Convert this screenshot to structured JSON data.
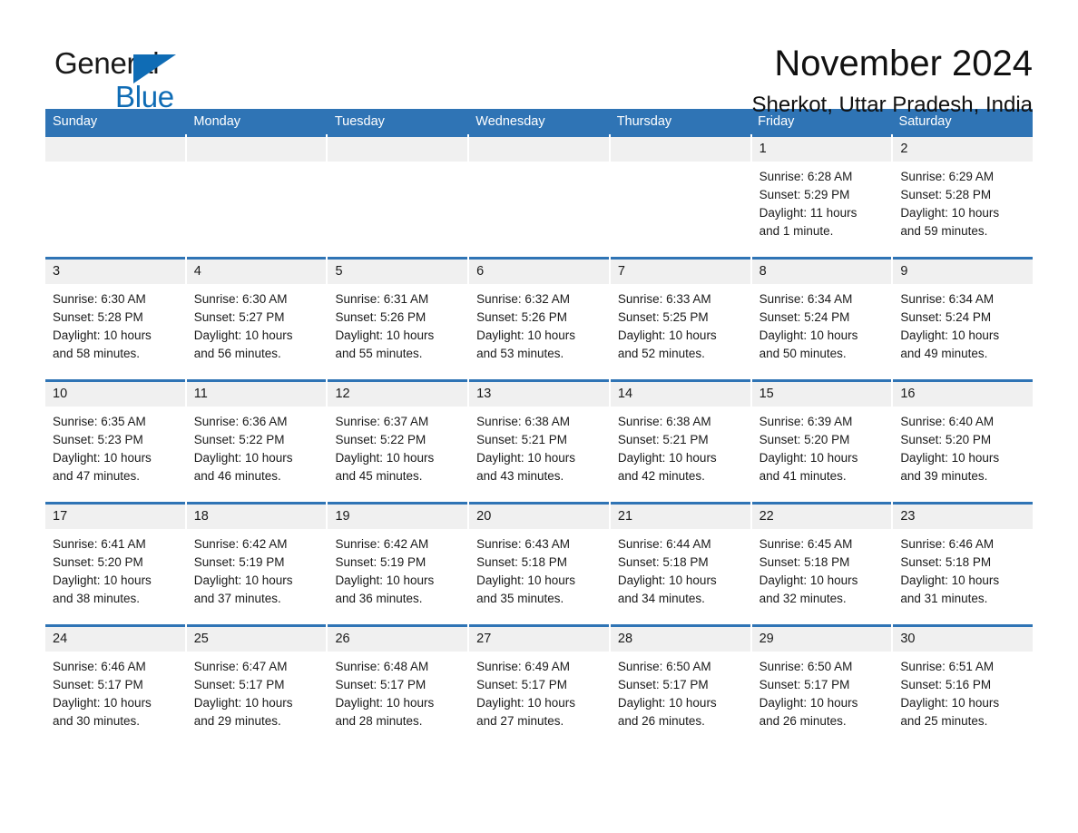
{
  "brand": {
    "word_one": "General",
    "word_two": "Blue",
    "flag_icon": "triangle-flag-icon",
    "accent_color": "#0f6cb5"
  },
  "header": {
    "title": "November 2024",
    "location": "Sherkot, Uttar Pradesh, India"
  },
  "calendar": {
    "header_bg": "#2f74b5",
    "date_strip_bg": "#f0f0f0",
    "weekdays": [
      "Sunday",
      "Monday",
      "Tuesday",
      "Wednesday",
      "Thursday",
      "Friday",
      "Saturday"
    ],
    "weeks": [
      [
        {
          "day": "",
          "sunrise": "",
          "sunset": "",
          "daylight_line1": "",
          "daylight_line2": ""
        },
        {
          "day": "",
          "sunrise": "",
          "sunset": "",
          "daylight_line1": "",
          "daylight_line2": ""
        },
        {
          "day": "",
          "sunrise": "",
          "sunset": "",
          "daylight_line1": "",
          "daylight_line2": ""
        },
        {
          "day": "",
          "sunrise": "",
          "sunset": "",
          "daylight_line1": "",
          "daylight_line2": ""
        },
        {
          "day": "",
          "sunrise": "",
          "sunset": "",
          "daylight_line1": "",
          "daylight_line2": ""
        },
        {
          "day": "1",
          "sunrise": "Sunrise: 6:28 AM",
          "sunset": "Sunset: 5:29 PM",
          "daylight_line1": "Daylight: 11 hours",
          "daylight_line2": "and 1 minute."
        },
        {
          "day": "2",
          "sunrise": "Sunrise: 6:29 AM",
          "sunset": "Sunset: 5:28 PM",
          "daylight_line1": "Daylight: 10 hours",
          "daylight_line2": "and 59 minutes."
        }
      ],
      [
        {
          "day": "3",
          "sunrise": "Sunrise: 6:30 AM",
          "sunset": "Sunset: 5:28 PM",
          "daylight_line1": "Daylight: 10 hours",
          "daylight_line2": "and 58 minutes."
        },
        {
          "day": "4",
          "sunrise": "Sunrise: 6:30 AM",
          "sunset": "Sunset: 5:27 PM",
          "daylight_line1": "Daylight: 10 hours",
          "daylight_line2": "and 56 minutes."
        },
        {
          "day": "5",
          "sunrise": "Sunrise: 6:31 AM",
          "sunset": "Sunset: 5:26 PM",
          "daylight_line1": "Daylight: 10 hours",
          "daylight_line2": "and 55 minutes."
        },
        {
          "day": "6",
          "sunrise": "Sunrise: 6:32 AM",
          "sunset": "Sunset: 5:26 PM",
          "daylight_line1": "Daylight: 10 hours",
          "daylight_line2": "and 53 minutes."
        },
        {
          "day": "7",
          "sunrise": "Sunrise: 6:33 AM",
          "sunset": "Sunset: 5:25 PM",
          "daylight_line1": "Daylight: 10 hours",
          "daylight_line2": "and 52 minutes."
        },
        {
          "day": "8",
          "sunrise": "Sunrise: 6:34 AM",
          "sunset": "Sunset: 5:24 PM",
          "daylight_line1": "Daylight: 10 hours",
          "daylight_line2": "and 50 minutes."
        },
        {
          "day": "9",
          "sunrise": "Sunrise: 6:34 AM",
          "sunset": "Sunset: 5:24 PM",
          "daylight_line1": "Daylight: 10 hours",
          "daylight_line2": "and 49 minutes."
        }
      ],
      [
        {
          "day": "10",
          "sunrise": "Sunrise: 6:35 AM",
          "sunset": "Sunset: 5:23 PM",
          "daylight_line1": "Daylight: 10 hours",
          "daylight_line2": "and 47 minutes."
        },
        {
          "day": "11",
          "sunrise": "Sunrise: 6:36 AM",
          "sunset": "Sunset: 5:22 PM",
          "daylight_line1": "Daylight: 10 hours",
          "daylight_line2": "and 46 minutes."
        },
        {
          "day": "12",
          "sunrise": "Sunrise: 6:37 AM",
          "sunset": "Sunset: 5:22 PM",
          "daylight_line1": "Daylight: 10 hours",
          "daylight_line2": "and 45 minutes."
        },
        {
          "day": "13",
          "sunrise": "Sunrise: 6:38 AM",
          "sunset": "Sunset: 5:21 PM",
          "daylight_line1": "Daylight: 10 hours",
          "daylight_line2": "and 43 minutes."
        },
        {
          "day": "14",
          "sunrise": "Sunrise: 6:38 AM",
          "sunset": "Sunset: 5:21 PM",
          "daylight_line1": "Daylight: 10 hours",
          "daylight_line2": "and 42 minutes."
        },
        {
          "day": "15",
          "sunrise": "Sunrise: 6:39 AM",
          "sunset": "Sunset: 5:20 PM",
          "daylight_line1": "Daylight: 10 hours",
          "daylight_line2": "and 41 minutes."
        },
        {
          "day": "16",
          "sunrise": "Sunrise: 6:40 AM",
          "sunset": "Sunset: 5:20 PM",
          "daylight_line1": "Daylight: 10 hours",
          "daylight_line2": "and 39 minutes."
        }
      ],
      [
        {
          "day": "17",
          "sunrise": "Sunrise: 6:41 AM",
          "sunset": "Sunset: 5:20 PM",
          "daylight_line1": "Daylight: 10 hours",
          "daylight_line2": "and 38 minutes."
        },
        {
          "day": "18",
          "sunrise": "Sunrise: 6:42 AM",
          "sunset": "Sunset: 5:19 PM",
          "daylight_line1": "Daylight: 10 hours",
          "daylight_line2": "and 37 minutes."
        },
        {
          "day": "19",
          "sunrise": "Sunrise: 6:42 AM",
          "sunset": "Sunset: 5:19 PM",
          "daylight_line1": "Daylight: 10 hours",
          "daylight_line2": "and 36 minutes."
        },
        {
          "day": "20",
          "sunrise": "Sunrise: 6:43 AM",
          "sunset": "Sunset: 5:18 PM",
          "daylight_line1": "Daylight: 10 hours",
          "daylight_line2": "and 35 minutes."
        },
        {
          "day": "21",
          "sunrise": "Sunrise: 6:44 AM",
          "sunset": "Sunset: 5:18 PM",
          "daylight_line1": "Daylight: 10 hours",
          "daylight_line2": "and 34 minutes."
        },
        {
          "day": "22",
          "sunrise": "Sunrise: 6:45 AM",
          "sunset": "Sunset: 5:18 PM",
          "daylight_line1": "Daylight: 10 hours",
          "daylight_line2": "and 32 minutes."
        },
        {
          "day": "23",
          "sunrise": "Sunrise: 6:46 AM",
          "sunset": "Sunset: 5:18 PM",
          "daylight_line1": "Daylight: 10 hours",
          "daylight_line2": "and 31 minutes."
        }
      ],
      [
        {
          "day": "24",
          "sunrise": "Sunrise: 6:46 AM",
          "sunset": "Sunset: 5:17 PM",
          "daylight_line1": "Daylight: 10 hours",
          "daylight_line2": "and 30 minutes."
        },
        {
          "day": "25",
          "sunrise": "Sunrise: 6:47 AM",
          "sunset": "Sunset: 5:17 PM",
          "daylight_line1": "Daylight: 10 hours",
          "daylight_line2": "and 29 minutes."
        },
        {
          "day": "26",
          "sunrise": "Sunrise: 6:48 AM",
          "sunset": "Sunset: 5:17 PM",
          "daylight_line1": "Daylight: 10 hours",
          "daylight_line2": "and 28 minutes."
        },
        {
          "day": "27",
          "sunrise": "Sunrise: 6:49 AM",
          "sunset": "Sunset: 5:17 PM",
          "daylight_line1": "Daylight: 10 hours",
          "daylight_line2": "and 27 minutes."
        },
        {
          "day": "28",
          "sunrise": "Sunrise: 6:50 AM",
          "sunset": "Sunset: 5:17 PM",
          "daylight_line1": "Daylight: 10 hours",
          "daylight_line2": "and 26 minutes."
        },
        {
          "day": "29",
          "sunrise": "Sunrise: 6:50 AM",
          "sunset": "Sunset: 5:17 PM",
          "daylight_line1": "Daylight: 10 hours",
          "daylight_line2": "and 26 minutes."
        },
        {
          "day": "30",
          "sunrise": "Sunrise: 6:51 AM",
          "sunset": "Sunset: 5:16 PM",
          "daylight_line1": "Daylight: 10 hours",
          "daylight_line2": "and 25 minutes."
        }
      ]
    ]
  }
}
